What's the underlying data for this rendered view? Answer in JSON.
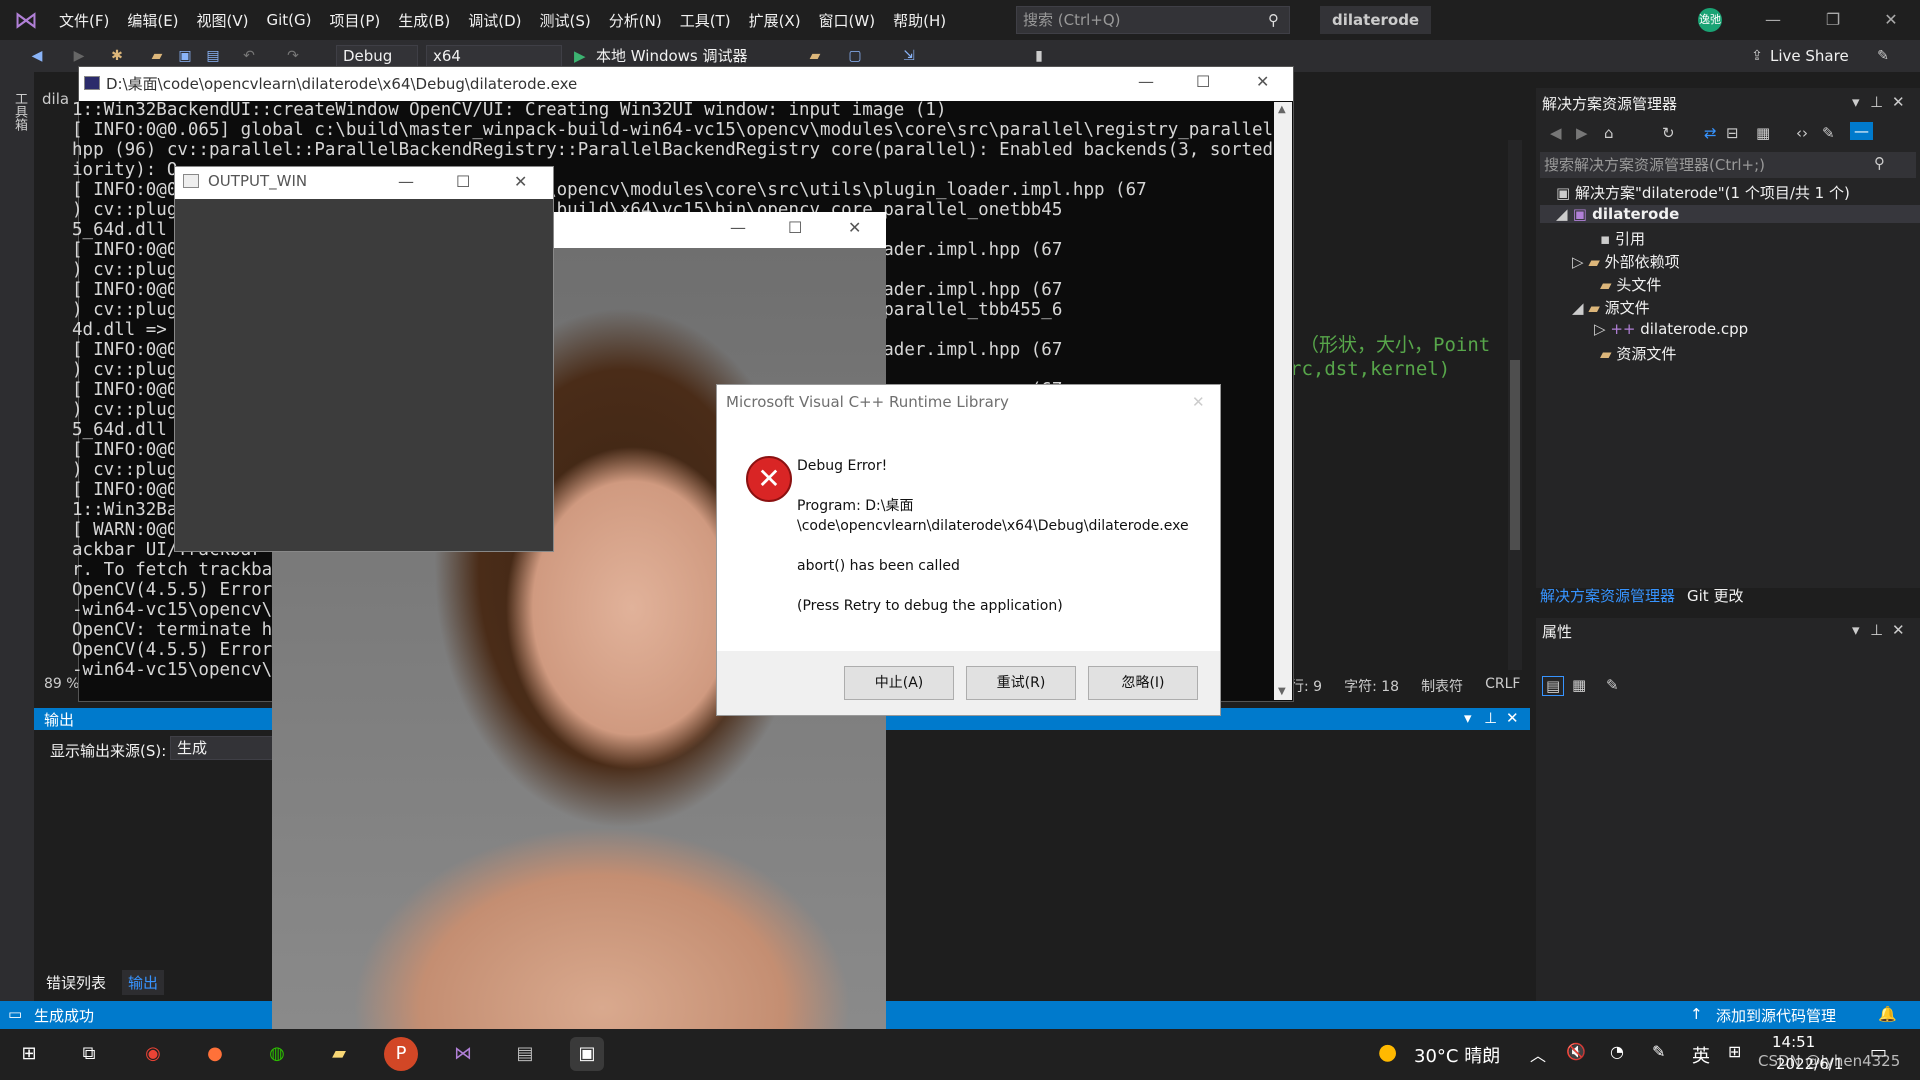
{
  "vs": {
    "menu": [
      "文件(F)",
      "编辑(E)",
      "视图(V)",
      "Git(G)",
      "项目(P)",
      "生成(B)",
      "调试(D)",
      "测试(S)",
      "分析(N)",
      "工具(T)",
      "扩展(X)",
      "窗口(W)",
      "帮助(H)"
    ],
    "search_placeholder": "搜索 (Ctrl+Q)",
    "solution_tag": "dilaterode",
    "avatar_text": "逸弛",
    "toolbar": {
      "config": "Debug",
      "platform": "x64",
      "run": "本地 Windows 调试器",
      "live_share": "Live Share"
    },
    "left_strip_label": "工具箱",
    "editor": {
      "tab_label": "dila",
      "code_line_1": "（形状，大小，Point",
      "code_line_2": "rc,dst,kernel)",
      "zoom": "89 %",
      "status": [
        "行: 9",
        "字符: 18",
        "制表符",
        "CRLF"
      ]
    },
    "output": {
      "title": "输出",
      "source_label": "显示输出来源(S):",
      "source_value": "生成"
    },
    "bottom_tabs": [
      "错误列表",
      "输出"
    ],
    "solution_explorer": {
      "title": "解决方案资源管理器",
      "search_placeholder": "搜索解决方案资源管理器(Ctrl+;)",
      "items": [
        {
          "label": "解决方案\"dilaterode\"(1 个项目/共 1 个)"
        },
        {
          "label": "dilaterode"
        },
        {
          "label": "引用"
        },
        {
          "label": "外部依赖项"
        },
        {
          "label": "头文件"
        },
        {
          "label": "源文件"
        },
        {
          "label": "dilaterode.cpp"
        },
        {
          "label": "资源文件"
        }
      ],
      "tabs": [
        "解决方案资源管理器",
        "Git 更改"
      ]
    },
    "properties_title": "属性",
    "status": {
      "text": "生成成功",
      "source_control": "添加到源代码管理"
    }
  },
  "console": {
    "title": "D:\\桌面\\code\\opencvlearn\\dilaterode\\x64\\Debug\\dilaterode.exe",
    "lines": [
      "1::Win32BackendUI::createWindow OpenCV/UI: Creating Win32UI window: input image (1)",
      "[ INFO:0@0.065] global c:\\build\\master_winpack-build-win64-vc15\\opencv\\modules\\core\\src\\parallel\\registry_parallel.impl.",
      "hpp (96) cv::parallel::ParallelBackendRegistry::ParallelBackendRegistry core(parallel): Enabled backends(3, sorted by pr",
      "iority): O",
      "[ INFO:0@0                    uild-win64-vc15\\opencv\\modules\\core\\src\\utils\\plugin_loader.impl.hpp (67",
      ") cv::plug                    D:\\tools\\opencv\\build\\x64\\vc15\\bin\\opencv_core_parallel_onetbb45",
      "5_64d.dll",
      "[ INFO:0@0                                             re\\src\\utils\\plugin_loader.impl.hpp (67",
      ") cv::plug                                             4d.dll => FAILED",
      "[ INFO:0@0                                             re\\src\\utils\\plugin_loader.impl.hpp (67",
      ") cv::plug                                             \\vc15\\bin\\opencv_core_parallel_tbb455_6",
      "4d.dll =>",
      "[ INFO:0@0                                             re\\src\\utils\\plugin_loader.impl.hpp (67",
      ") cv::plug                                             dll => FAILED",
      "[ INFO:0@0                                                                               p (67",
      ") cv::plug                                                                               nmp45",
      "5_64d.dll",
      "[ INFO:0@0                                                                               p (67",
      ") cv::plug",
      "[ INFO:0@0",
      "1::Win32Ba                                                                               ::imp",
      "[ WARN:0@0",
      "ackbar UI/Trackbar",
      "r. To fetch trackbar                                                                     ateTr",
      "OpenCV(4.5.5) Error:                                                                     ointe",
      "-win64-vc15\\opencv\\m                                                                   build",
      "OpenCV: terminate ha",
      "OpenCV(4.5.5) Error:                                                                     build",
      "-win64-vc15\\opencv\\m"
    ]
  },
  "output_win": {
    "title": "OUTPUT_WIN"
  },
  "dialog": {
    "title": "Microsoft Visual C++ Runtime Library",
    "heading": "Debug Error!",
    "program_label": "Program: D:\\桌面",
    "program_path": "\\code\\opencvlearn\\dilaterode\\x64\\Debug\\dilaterode.exe",
    "message": "abort() has been called",
    "hint": "(Press Retry to debug the application)",
    "buttons": [
      "中止(A)",
      "重试(R)",
      "忽略(I)"
    ]
  },
  "taskbar": {
    "weather": "30°C 晴朗",
    "ime": "英",
    "time": "14:51",
    "date": "2022/6/1",
    "watermark": "CSDN @Iyhen4325"
  }
}
